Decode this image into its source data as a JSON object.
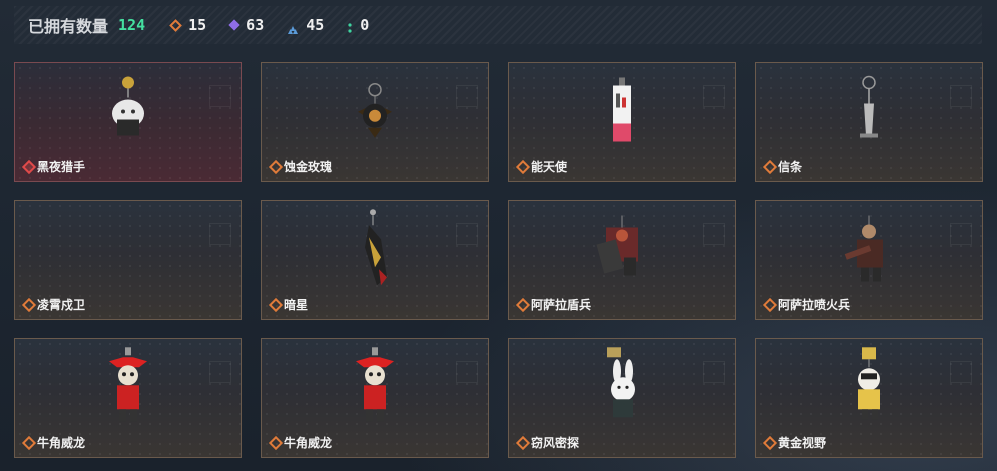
{
  "stats": {
    "owned_label": "已拥有数量",
    "owned_total": "124",
    "counts": [
      {
        "icon": "orange-diamond-icon",
        "value": "15",
        "color": "#e07b3a"
      },
      {
        "icon": "purple-diamond-icon",
        "value": "63",
        "color": "#8f6de8"
      },
      {
        "icon": "blue-triangles-icon",
        "value": "45",
        "color": "#5a9ad8"
      },
      {
        "icon": "green-dots-icon",
        "value": "0",
        "color": "#3fd4a0"
      }
    ]
  },
  "items": [
    {
      "name": "黑夜猎手",
      "rarity": "red",
      "art": "hunter"
    },
    {
      "name": "蚀金玫瑰",
      "rarity": "orange",
      "art": "rose"
    },
    {
      "name": "能天使",
      "rarity": "orange",
      "art": "tag"
    },
    {
      "name": "信条",
      "rarity": "orange",
      "art": "key"
    },
    {
      "name": "凌霄戍卫",
      "rarity": "orange",
      "art": "none"
    },
    {
      "name": "暗星",
      "rarity": "orange",
      "art": "blade"
    },
    {
      "name": "阿萨拉盾兵",
      "rarity": "orange",
      "art": "shield"
    },
    {
      "name": "阿萨拉喷火兵",
      "rarity": "orange",
      "art": "flamer"
    },
    {
      "name": "牛角威龙",
      "rarity": "orange",
      "art": "bull"
    },
    {
      "name": "牛角威龙",
      "rarity": "orange",
      "art": "bull"
    },
    {
      "name": "窃风密探",
      "rarity": "orange",
      "art": "rabbit"
    },
    {
      "name": "黄金视野",
      "rarity": "orange",
      "art": "gold"
    }
  ]
}
